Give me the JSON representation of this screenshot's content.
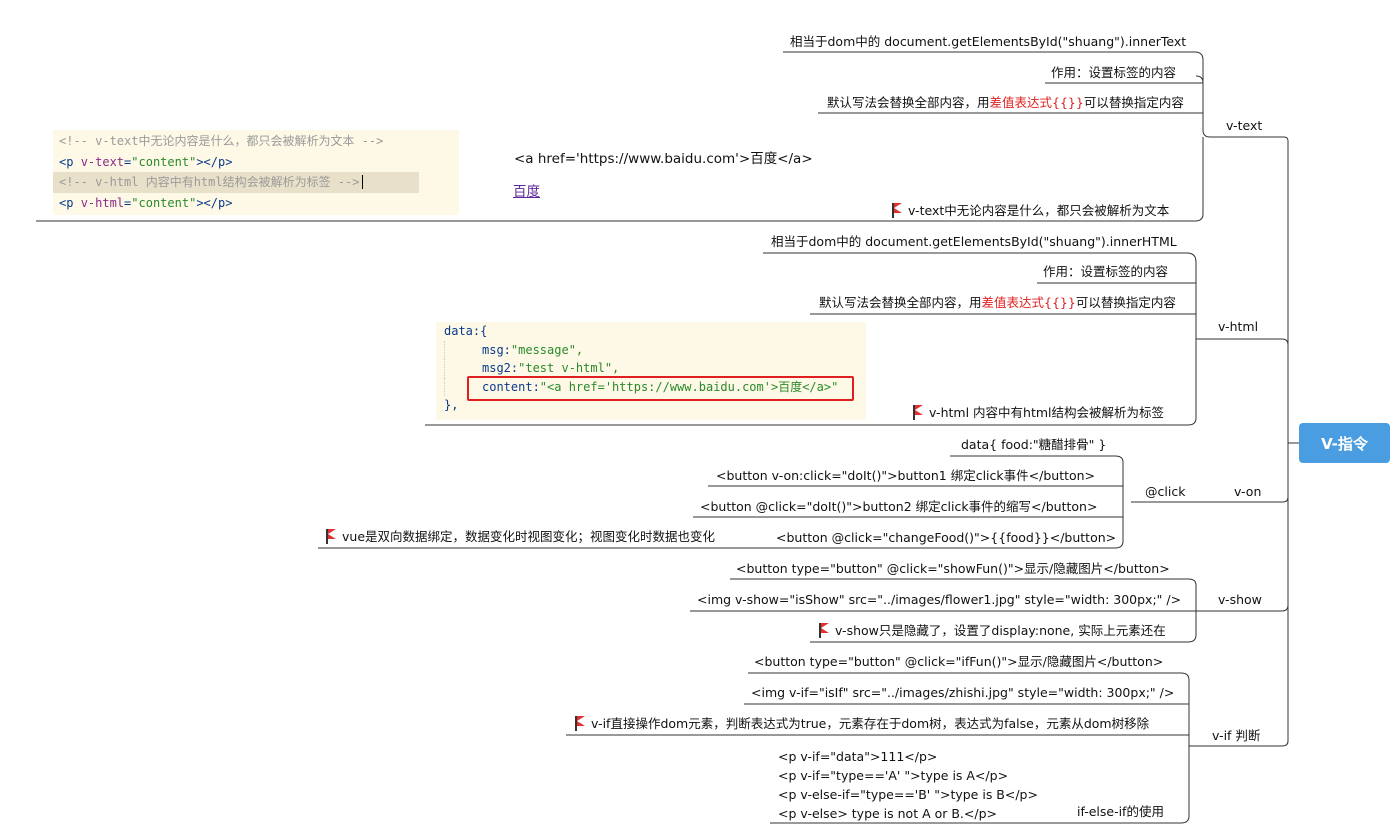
{
  "root": {
    "label": "V-指令"
  },
  "vtext": {
    "label": "v-text",
    "items": [
      "相当于dom中的 document.getElementsById(\"shuang\").innerText",
      "作用：设置标签的内容"
    ],
    "default_pre": "默认写法会替换全部内容，用",
    "default_hl": "差值表达式{{}}",
    "default_post": "可以替换指定内容",
    "flag_text": "v-text中无论内容是什么，都只会被解析为文本",
    "code": {
      "line1": "<!-- v-text中无论内容是什么，都只会被解析为文本 -->",
      "line2_tag_open": "<p ",
      "line2_attr": "v-text",
      "line2_eq": "=",
      "line2_val": "\"content\"",
      "line2_close": "></p>",
      "line3": "<!-- v-html 内容中有html结构会被解析为标签 -->",
      "line4_tag_open": "<p ",
      "line4_attr": "v-html",
      "line4_eq": "=",
      "line4_val": "\"content\"",
      "line4_close": "></p>"
    },
    "render_text": "<a href='https://www.baidu.com'>百度</a>",
    "render_link": "百度"
  },
  "vhtml": {
    "label": "v-html",
    "items": [
      "相当于dom中的 document.getElementsById(\"shuang\").innerHTML",
      "作用：设置标签的内容"
    ],
    "default_pre": "默认写法会替换全部内容，用",
    "default_hl": "差值表达式{{}}",
    "default_post": "可以替换指定内容",
    "flag_text": "v-html 内容中有html结构会被解析为标签",
    "code": {
      "line1": "data:{",
      "line2_key": "msg:",
      "line2_val": "\"message\",",
      "line3_key": "msg2:",
      "line3_val": "\"test v-html\",",
      "line4_key": "content:",
      "line4_val": "\"<a href='https://www.baidu.com'>百度</a>\"",
      "line5": "},"
    }
  },
  "von": {
    "label": "v-on",
    "sub_label": "@click",
    "data_line": "data{ food:\"糖醋排骨\" }",
    "items": [
      "<button v-on:click=\"doIt()\">button1  绑定click事件</button>",
      "<button @click=\"doIt()\">button2 绑定click事件的缩写</button>",
      "<button @click=\"changeFood()\">{{food}}</button>"
    ],
    "flag_text": "vue是双向数据绑定，数据变化时视图变化；视图变化时数据也变化"
  },
  "vshow": {
    "label": "v-show",
    "items": [
      "<button type=\"button\" @click=\"showFun()\">显示/隐藏图片</button>",
      "<img v-show=\"isShow\" src=\"../images/flower1.jpg\" style=\"width: 300px;\" />"
    ],
    "flag_text": "v-show只是隐藏了，设置了display:none, 实际上元素还在"
  },
  "vif": {
    "label": "v-if 判断",
    "items": [
      "<button type=\"button\" @click=\"ifFun()\">显示/隐藏图片</button>",
      "<img v-if=\"isIf\" src=\"../images/zhishi.jpg\" style=\"width: 300px;\" />"
    ],
    "flag_text": "v-if直接操作dom元素，判断表达式为true，元素存在于dom树，表达式为false，元素从dom树移除",
    "code_lines": [
      "<p v-if=\"data\">111</p>",
      "<p v-if=\"type=='A' \">type is A</p>",
      "<p v-else-if=\"type=='B' \">type is B</p>",
      "<p v-else> type is not A or B.</p>"
    ],
    "code_label": "if-else-if的使用"
  },
  "colors": {
    "root": "#4a9de0",
    "highlight": "#e02020",
    "line": "#333333",
    "code_bg": "#fdf9e6"
  }
}
